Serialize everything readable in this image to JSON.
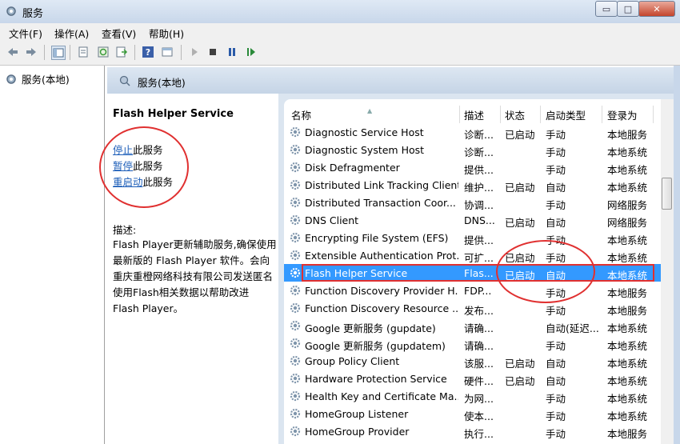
{
  "window": {
    "title": "服务",
    "minimize": "▭",
    "maximize": "□",
    "close": "✕"
  },
  "menu": [
    "文件(F)",
    "操作(A)",
    "查看(V)",
    "帮助(H)"
  ],
  "tree": {
    "label": "服务(本地)"
  },
  "panel": {
    "header": "服务(本地)"
  },
  "detail": {
    "service_name": "Flash Helper Service",
    "stop_link": "停止",
    "stop_suffix": "此服务",
    "pause_link": "暂停",
    "pause_suffix": "此服务",
    "restart_link": "重启动",
    "restart_suffix": "此服务",
    "desc_label": "描述:",
    "desc_text": "Flash Player更新辅助服务,确保使用最新版的 Flash Player 软件。会向重庆重橙网络科技有限公司发送匿名使用Flash相关数据以帮助改进 Flash Player。"
  },
  "columns": [
    "名称",
    "描述",
    "状态",
    "启动类型",
    "登录为"
  ],
  "rows": [
    {
      "name": "Diagnostic Service Host",
      "desc": "诊断...",
      "status": "已启动",
      "startup": "手动",
      "logon": "本地服务"
    },
    {
      "name": "Diagnostic System Host",
      "desc": "诊断...",
      "status": "",
      "startup": "手动",
      "logon": "本地系统"
    },
    {
      "name": "Disk Defragmenter",
      "desc": "提供...",
      "status": "",
      "startup": "手动",
      "logon": "本地系统"
    },
    {
      "name": "Distributed Link Tracking Client",
      "desc": "维护...",
      "status": "已启动",
      "startup": "自动",
      "logon": "本地系统"
    },
    {
      "name": "Distributed Transaction Coor...",
      "desc": "协调...",
      "status": "",
      "startup": "手动",
      "logon": "网络服务"
    },
    {
      "name": "DNS Client",
      "desc": "DNS...",
      "status": "已启动",
      "startup": "自动",
      "logon": "网络服务"
    },
    {
      "name": "Encrypting File System (EFS)",
      "desc": "提供...",
      "status": "",
      "startup": "手动",
      "logon": "本地系统"
    },
    {
      "name": "Extensible Authentication Prot...",
      "desc": "可扩...",
      "status": "已启动",
      "startup": "手动",
      "logon": "本地系统"
    },
    {
      "name": "Flash Helper Service",
      "desc": "Flas...",
      "status": "已启动",
      "startup": "自动",
      "logon": "本地系统"
    },
    {
      "name": "Function Discovery Provider H...",
      "desc": "FDP...",
      "status": "",
      "startup": "手动",
      "logon": "本地服务"
    },
    {
      "name": "Function Discovery Resource ...",
      "desc": "发布...",
      "status": "",
      "startup": "手动",
      "logon": "本地服务"
    },
    {
      "name": "Google 更新服务 (gupdate)",
      "desc": "请确...",
      "status": "",
      "startup": "自动(延迟...",
      "logon": "本地系统"
    },
    {
      "name": "Google 更新服务 (gupdatem)",
      "desc": "请确...",
      "status": "",
      "startup": "手动",
      "logon": "本地系统"
    },
    {
      "name": "Group Policy Client",
      "desc": "该服...",
      "status": "已启动",
      "startup": "自动",
      "logon": "本地系统"
    },
    {
      "name": "Hardware Protection Service",
      "desc": "硬件...",
      "status": "已启动",
      "startup": "自动",
      "logon": "本地系统"
    },
    {
      "name": "Health Key and Certificate Ma...",
      "desc": "为网...",
      "status": "",
      "startup": "手动",
      "logon": "本地系统"
    },
    {
      "name": "HomeGroup Listener",
      "desc": "使本...",
      "status": "",
      "startup": "手动",
      "logon": "本地系统"
    },
    {
      "name": "HomeGroup Provider",
      "desc": "执行...",
      "status": "",
      "startup": "手动",
      "logon": "本地服务"
    }
  ],
  "selected_row": 8,
  "colors": {
    "selection": "#3399ff",
    "annotation": "#e03030",
    "link": "#1a5cb8"
  }
}
